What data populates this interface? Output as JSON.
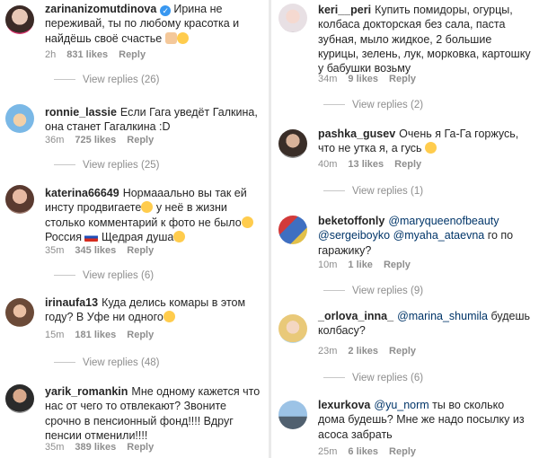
{
  "left": [
    {
      "user": "zarinanizomutdinova",
      "verified": true,
      "text": "Ирина не переживай, ты по любому красотка и найдёшь своё счастье ",
      "emojis": [
        "hand",
        "face"
      ],
      "time": "2h",
      "likes": "831 likes",
      "reply": "Reply",
      "view_replies": "View replies (26)"
    },
    {
      "user": "ronnie_lassie",
      "text": "Если Гага уведёт Галкина, она станет Гагалкина :D",
      "time": "36m",
      "likes": "725 likes",
      "reply": "Reply",
      "view_replies": "View replies (25)"
    },
    {
      "user": "katerina66649",
      "text": "Нормааально вы так ей инсту продвигаете",
      "text2": " у неё в жизни столько комментарий к фото не было",
      "text3": " Россия ",
      "text4": " Щедрая душа",
      "time": "35m",
      "likes": "345 likes",
      "reply": "Reply",
      "view_replies": "View replies (6)"
    },
    {
      "user": "irinaufa13",
      "text": "Куда делись комары в этом году? В Уфе ни одного",
      "time": "15m",
      "likes": "181 likes",
      "reply": "Reply",
      "view_replies": "View replies (48)"
    },
    {
      "user": "yarik_romankin",
      "text": "Мне одному кажется что нас от чего то отвлекают? Звоните срочно в пенсионный фонд!!!! Вдруг пенсии отменили!!!!",
      "time": "35m",
      "likes": "389 likes",
      "reply": "Reply"
    }
  ],
  "right": [
    {
      "user": "keri__peri",
      "text": "Купить помидоры, огурцы, колбаса докторская без сала, паста зубная, мыло жидкое, 2 большие курицы, зелень, лук, морковка, картошку у бабушки возьму",
      "time": "34m",
      "likes": "9 likes",
      "reply": "Reply",
      "view_replies": "View replies (2)"
    },
    {
      "user": "pashka_gusev",
      "text": "Очень я Га-Га горжусь, что не утка я, а гусь ",
      "time": "40m",
      "likes": "13 likes",
      "reply": "Reply",
      "view_replies": "View replies (1)"
    },
    {
      "user": "beketoffonly",
      "mention1": "@maryqueenofbeauty",
      "mention2": "@sergeiboyko",
      "mention3": "@myaha_ataevna",
      "text": " го по гаражику?",
      "time": "10m",
      "likes": "1 like",
      "reply": "Reply",
      "view_replies": "View replies (9)"
    },
    {
      "user": "_orlova_inna_",
      "mention1": "@marina_shumila",
      "text": " будешь колбасу?",
      "time": "23m",
      "likes": "2 likes",
      "reply": "Reply",
      "view_replies": "View replies (6)"
    },
    {
      "user": "lexurkova",
      "mention1": "@yu_norm",
      "text": " ты во сколько дома будешь? Мне же надо посылку из асоса забрать",
      "time": "25m",
      "likes": "6 likes",
      "reply": "Reply"
    }
  ],
  "colors": {
    "text": "#262626",
    "meta": "#8e8e8e",
    "mention": "#003569",
    "verified": "#3897f0"
  }
}
